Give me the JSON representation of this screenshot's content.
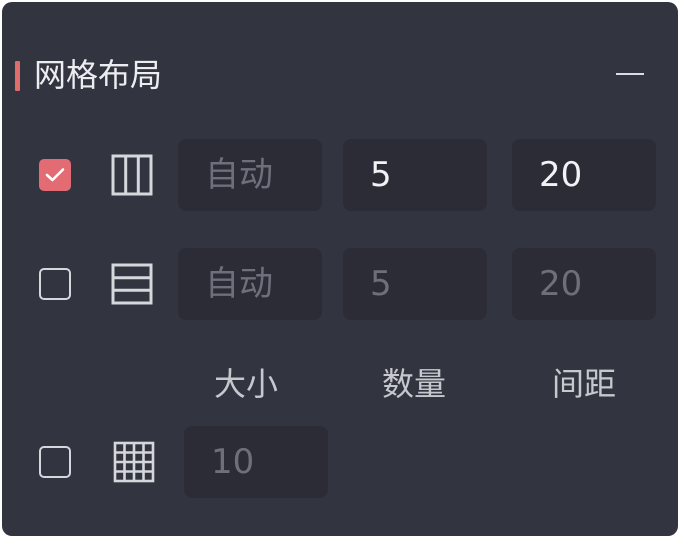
{
  "panel": {
    "title": "网格布局"
  },
  "rows": [
    {
      "checked": true,
      "icon": "column-layout-icon",
      "fields": [
        "自动",
        "5",
        "20"
      ]
    },
    {
      "checked": false,
      "icon": "row-layout-icon",
      "fields": [
        "自动",
        "5",
        "20"
      ]
    }
  ],
  "labels": {
    "size": "大小",
    "count": "数量",
    "gap": "间距"
  },
  "grid_row": {
    "checked": false,
    "icon": "grid-layout-icon",
    "value": "10"
  },
  "colors": {
    "accent": "#e36b73",
    "panel_bg": "#323440",
    "field_bg": "#2b2c36"
  }
}
